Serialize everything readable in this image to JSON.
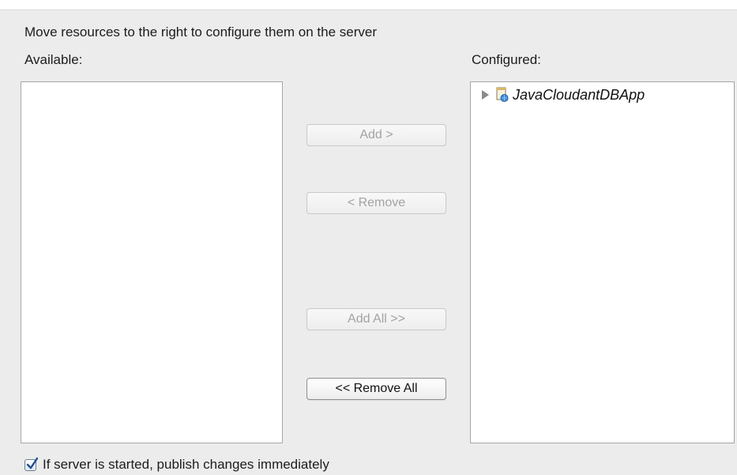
{
  "instruction": "Move resources to the right to configure them on the server",
  "available": {
    "label": "Available:",
    "items": []
  },
  "configured": {
    "label": "Configured:",
    "items": [
      {
        "label": "JavaCloudantDBApp",
        "icon": "web-project-icon",
        "expanded": false
      }
    ]
  },
  "buttons": {
    "add": {
      "label": "Add >",
      "enabled": false
    },
    "remove": {
      "label": "< Remove",
      "enabled": false
    },
    "add_all": {
      "label": "Add All >>",
      "enabled": false
    },
    "remove_all": {
      "label": "<< Remove All",
      "enabled": true
    }
  },
  "publish": {
    "label": "If server is started, publish changes immediately",
    "checked": true
  },
  "colors": {
    "panel_background": "#ececec",
    "checkbox_check": "#1f4f8f",
    "disabled_text": "#a3a3a3"
  }
}
